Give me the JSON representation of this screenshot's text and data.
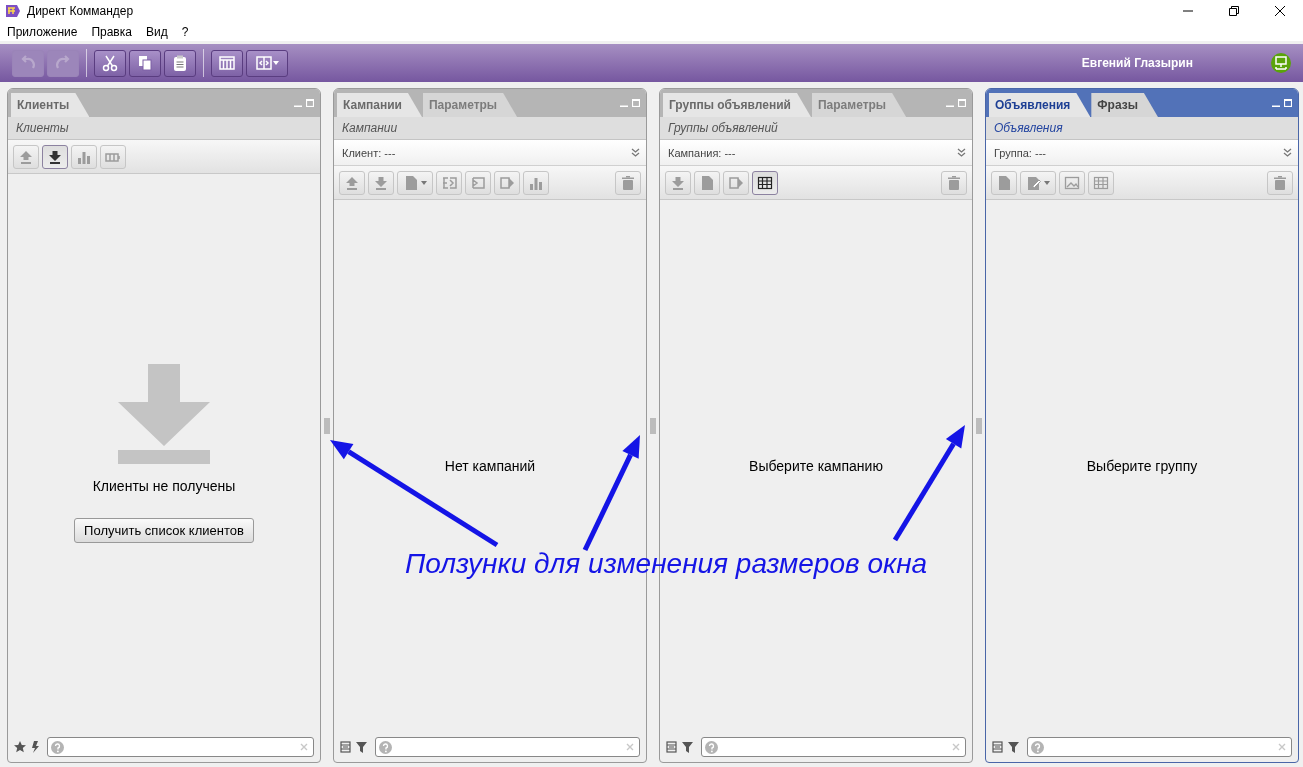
{
  "window": {
    "title": "Директ Коммандер"
  },
  "menu": [
    {
      "label": "Приложение"
    },
    {
      "label": "Правка"
    },
    {
      "label": "Вид"
    },
    {
      "label": "?"
    }
  ],
  "main_toolbar": [
    {
      "kind": "undo",
      "disabled": true
    },
    {
      "kind": "redo",
      "disabled": true
    },
    {
      "kind": "separator"
    },
    {
      "kind": "cut",
      "disabled": false
    },
    {
      "kind": "copy",
      "disabled": false
    },
    {
      "kind": "paste",
      "disabled": false
    },
    {
      "kind": "separator"
    },
    {
      "kind": "columns",
      "disabled": false
    },
    {
      "kind": "layout",
      "disabled": false
    }
  ],
  "user": {
    "name": "Евгений Глазырин"
  },
  "panels": [
    {
      "active": false,
      "tabs": [
        {
          "label": "Клиенты",
          "selected": true
        }
      ],
      "subtitle": "Клиенты",
      "tools": [
        {
          "kind": "upload",
          "pressed": false
        },
        {
          "kind": "download",
          "pressed": true
        },
        {
          "kind": "chart",
          "pressed": false
        },
        {
          "kind": "battery",
          "pressed": false
        }
      ],
      "trash": false,
      "body": {
        "kind": "empty",
        "message": "Клиенты не получены",
        "button": "Получить список клиентов"
      },
      "footer_icons": [
        {
          "kind": "star"
        },
        {
          "kind": "bolt"
        }
      ]
    },
    {
      "active": false,
      "tabs": [
        {
          "label": "Кампании",
          "selected": true
        },
        {
          "label": "Параметры",
          "selected": false
        }
      ],
      "subtitle": "Кампании",
      "filter": "Клиент: ---",
      "tools": [
        {
          "kind": "upload",
          "pressed": false
        },
        {
          "kind": "download",
          "pressed": false
        },
        {
          "kind": "file-menu",
          "pressed": false
        },
        {
          "kind": "frame-split",
          "pressed": false
        },
        {
          "kind": "bracket",
          "pressed": false
        },
        {
          "kind": "frame-arrow",
          "pressed": false
        },
        {
          "kind": "chart",
          "pressed": false
        }
      ],
      "trash": true,
      "body": {
        "kind": "message",
        "message": "Нет кампаний"
      },
      "footer_icons": [
        {
          "kind": "list"
        },
        {
          "kind": "filter"
        }
      ]
    },
    {
      "active": false,
      "tabs": [
        {
          "label": "Группы объявлений",
          "selected": true
        },
        {
          "label": "Параметры",
          "selected": false
        }
      ],
      "subtitle": "Группы объявлений",
      "filter": "Кампания: ---",
      "tools": [
        {
          "kind": "download",
          "pressed": false
        },
        {
          "kind": "file",
          "pressed": false
        },
        {
          "kind": "frame-arrow",
          "pressed": false
        },
        {
          "kind": "table",
          "pressed": true
        }
      ],
      "trash": true,
      "body": {
        "kind": "message",
        "message": "Выберите кампанию"
      },
      "footer_icons": [
        {
          "kind": "list"
        },
        {
          "kind": "filter"
        }
      ]
    },
    {
      "active": true,
      "tabs": [
        {
          "label": "Объявления",
          "selected": true
        },
        {
          "label": "Фразы",
          "selected": false
        }
      ],
      "subtitle": "Объявления",
      "filter": "Группа: ---",
      "tools": [
        {
          "kind": "file",
          "pressed": false
        },
        {
          "kind": "edit-menu",
          "pressed": false
        },
        {
          "kind": "image",
          "pressed": false
        },
        {
          "kind": "table",
          "pressed": false
        }
      ],
      "trash": true,
      "body": {
        "kind": "message",
        "message": "Выберите группу"
      },
      "footer_icons": [
        {
          "kind": "list"
        },
        {
          "kind": "filter"
        }
      ]
    }
  ],
  "annotation": {
    "text": "Ползунки для изменения размеров окна"
  }
}
